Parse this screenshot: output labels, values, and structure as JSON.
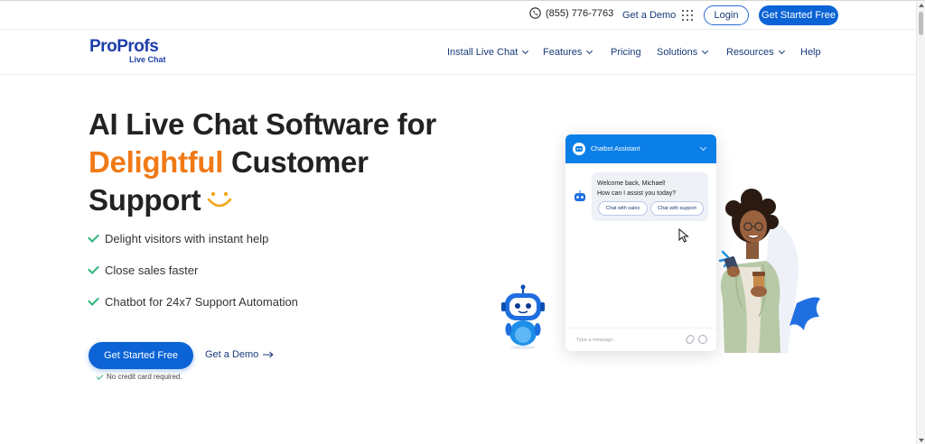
{
  "topbar": {
    "phone": "(855) 776-7763",
    "demo_label": "Get a Demo",
    "login_label": "Login",
    "get_started_label": "Get Started Free"
  },
  "nav": {
    "logo_pro1": "Pro",
    "logo_pro2": "Profs",
    "logo_sub": "Live Chat",
    "items": [
      {
        "label": "Install Live Chat",
        "has_dropdown": true
      },
      {
        "label": "Features",
        "has_dropdown": true
      },
      {
        "label": "Pricing",
        "has_dropdown": false
      },
      {
        "label": "Solutions",
        "has_dropdown": true
      },
      {
        "label": "Resources",
        "has_dropdown": true
      },
      {
        "label": "Help",
        "has_dropdown": false
      }
    ]
  },
  "hero": {
    "title_line1": "AI Live Chat Software for",
    "title_accent": "Delightful",
    "title_line2_rest": " Customer",
    "title_line3": "Support",
    "features": [
      "Delight visitors with instant help",
      "Close sales faster",
      "Chatbot for 24x7 Support Automation"
    ],
    "cta_label": "Get Started Free",
    "demo_label": "Get a Demo",
    "no_cc": "No credit card required."
  },
  "chat": {
    "header": "Chatbot Assistant",
    "greeting_line1": "Welcome back, Michael!",
    "greeting_line2": "How can I assist you today?",
    "chip_sales": "Chat with sales",
    "chip_support": "Chat with support",
    "input_placeholder": "Type a message..."
  },
  "colors": {
    "primary": "#0b63d6",
    "accent": "#f07a16",
    "nav_text": "#1a3a7a",
    "check": "#2eb67d"
  }
}
